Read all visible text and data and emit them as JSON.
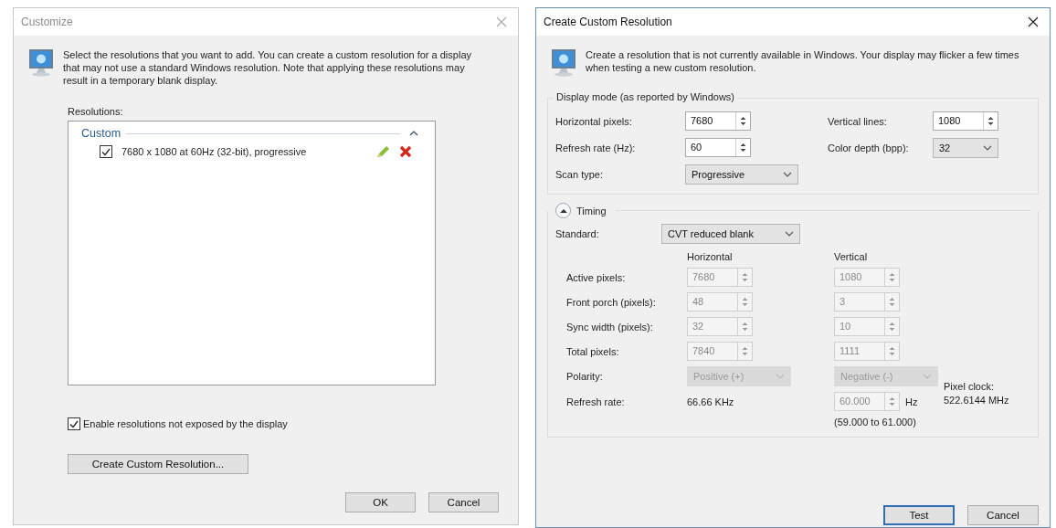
{
  "customize_dialog": {
    "title": "Customize",
    "description": "Select the resolutions that you want to add. You can create a custom resolution for a display that may not use a standard Windows resolution. Note that applying these resolutions may result in a temporary blank display.",
    "resolutions_label": "Resolutions:",
    "group": {
      "label": "Custom",
      "expanded": true
    },
    "resolutions": [
      {
        "text": "7680 x 1080 at 60Hz (32-bit), progressive",
        "checked": true
      }
    ],
    "enable_option": {
      "label": "Enable resolutions not exposed by the display",
      "checked": true
    },
    "create_button": "Create Custom Resolution...",
    "buttons": [
      "OK",
      "Cancel"
    ]
  },
  "create_dialog": {
    "title": "Create Custom Resolution",
    "description": "Create a resolution that is not currently available in Windows. Your display may flicker a few times when testing a new custom resolution.",
    "display_mode": {
      "title": "Display mode (as reported by Windows)",
      "left_fields": [
        {
          "label": "Horizontal pixels:",
          "value": "7680",
          "kind": "spin"
        },
        {
          "label": "Refresh rate (Hz):",
          "value": "60",
          "kind": "spin"
        },
        {
          "label": "Scan type:",
          "value": "Progressive",
          "kind": "select"
        }
      ],
      "right_fields": [
        {
          "label": "Vertical lines:",
          "value": "1080",
          "kind": "spin"
        },
        {
          "label": "Color depth (bpp):",
          "value": "32",
          "kind": "select"
        }
      ]
    },
    "timing": {
      "label": "Timing",
      "expanded": true,
      "standard": {
        "label": "Standard:",
        "value": "CVT reduced blank"
      },
      "columns": [
        "Horizontal",
        "Vertical"
      ],
      "rows": [
        {
          "label": "Active pixels:",
          "horizontal": "7680",
          "vertical": "1080",
          "disabled": true
        },
        {
          "label": "Front porch (pixels):",
          "horizontal": "48",
          "vertical": "3",
          "disabled": true
        },
        {
          "label": "Sync width (pixels):",
          "horizontal": "32",
          "vertical": "10",
          "disabled": true
        },
        {
          "label": "Total pixels:",
          "horizontal": "7840",
          "vertical": "1111",
          "disabled": true
        }
      ],
      "polarity": {
        "label": "Polarity:",
        "horizontal": "Positive (+)",
        "vertical": "Negative (-)",
        "disabled": true
      },
      "refresh": {
        "label": "Refresh rate:",
        "horizontal": "66.66 KHz",
        "vertical": "60.000",
        "unit": "Hz",
        "range": "(59.000 to 61.000)",
        "disabled": true
      },
      "pixel_clock": {
        "label": "Pixel clock:",
        "value": "522.6144 MHz"
      }
    },
    "buttons": [
      {
        "label": "Test",
        "default": true
      },
      {
        "label": "Cancel",
        "default": false
      }
    ]
  }
}
